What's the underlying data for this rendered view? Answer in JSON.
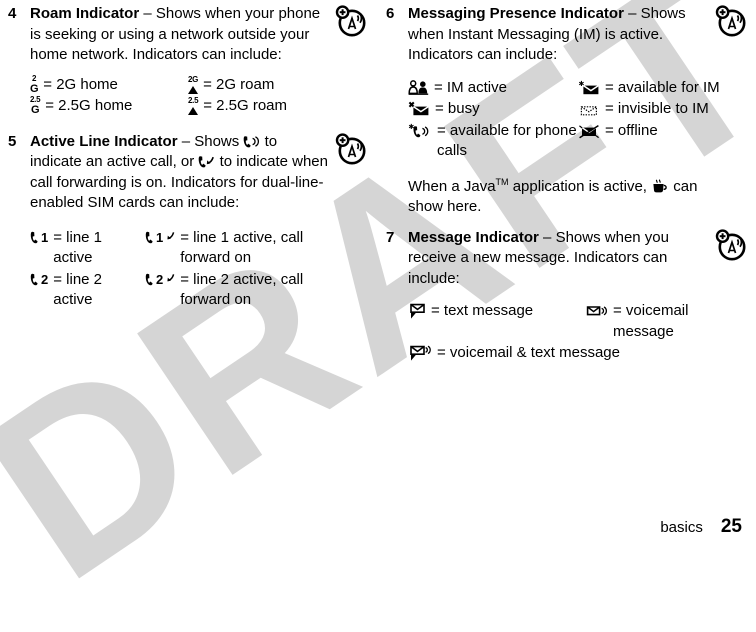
{
  "document": {
    "watermark": "DRAFT",
    "footer": {
      "section_label": "basics",
      "page_number": "25"
    }
  },
  "entries": [
    {
      "number": "4",
      "term": "Roam Indicator",
      "dash": " – ",
      "description": "Shows when your phone is seeking or using a network outside your home network. Indicators can include:",
      "side_icon": "roam-antenna-icon",
      "table": [
        [
          {
            "symbol": "2g-home-icon",
            "definition": "= 2G home"
          },
          {
            "symbol": "2g-roam-icon",
            "definition": "= 2G roam"
          }
        ],
        [
          {
            "symbol": "25g-home-icon",
            "definition": "= 2.5G home"
          },
          {
            "symbol": "25g-roam-icon",
            "definition": "= 2.5G roam"
          }
        ]
      ]
    },
    {
      "number": "5",
      "term": "Active Line Indicator",
      "dash": " – ",
      "desc_part1": "Shows ",
      "inline_icon1": "active-call-icon",
      "desc_part2": " to indicate an active call, or ",
      "inline_icon2": "call-forward-icon",
      "desc_part3": " to indicate when call forwarding is on. Indicators for dual-line-enabled SIM cards can include:",
      "side_icon": "roam-antenna-icon",
      "table": [
        [
          {
            "symbol": "line-1-active-icon",
            "definition": "= line 1 active"
          },
          {
            "symbol": "line-1-active-cf-icon",
            "definition": "= line 1 active, call forward on"
          }
        ],
        [
          {
            "symbol": "line-2-active-icon",
            "definition": "= line 2 active"
          },
          {
            "symbol": "line-2-active-cf-icon",
            "definition": "= line 2 active, call forward on"
          }
        ]
      ]
    },
    {
      "number": "6",
      "term": "Messaging Presence Indicator",
      "dash": " – ",
      "description": "Shows when Instant Messaging (IM) is active. Indicators can include:",
      "side_icon": "roam-antenna-icon",
      "table": [
        [
          {
            "symbol": "im-active-icon",
            "definition": "= IM active"
          },
          {
            "symbol": "available-for-im-icon",
            "definition": "= available for IM"
          }
        ],
        [
          {
            "symbol": "busy-icon",
            "definition": "= busy"
          },
          {
            "symbol": "invisible-to-im-icon",
            "definition": "= invisible to IM"
          }
        ],
        [
          {
            "symbol": "available-for-phone-calls-icon",
            "definition": "= available for phone calls"
          },
          {
            "symbol": "offline-icon",
            "definition": "= offline"
          }
        ]
      ],
      "note_part1": "When a Java",
      "note_tm": "TM",
      "note_part2": " application is active, ",
      "note_icon": "java-coffee-cup-icon",
      "note_part3": " can show here."
    },
    {
      "number": "7",
      "term": "Message Indicator",
      "dash": " – ",
      "description": "Shows when you receive a new message. Indicators can include:",
      "side_icon": "roam-antenna-icon",
      "table": [
        [
          {
            "symbol": "text-message-icon",
            "definition": "= text message"
          },
          {
            "symbol": "voicemail-message-icon",
            "definition": "= voicemail message"
          }
        ],
        [
          {
            "symbol": "voicemail-and-text-message-icon",
            "definition": "= voicemail & text message"
          }
        ]
      ]
    }
  ],
  "glyph_text": {
    "two": "2",
    "two_point_five": "2.5",
    "g": "G",
    "line1": "1",
    "line2": "2"
  },
  "colors": {
    "ink": "#000000",
    "watermark": "#d5d5d5",
    "page": "#ffffff"
  }
}
